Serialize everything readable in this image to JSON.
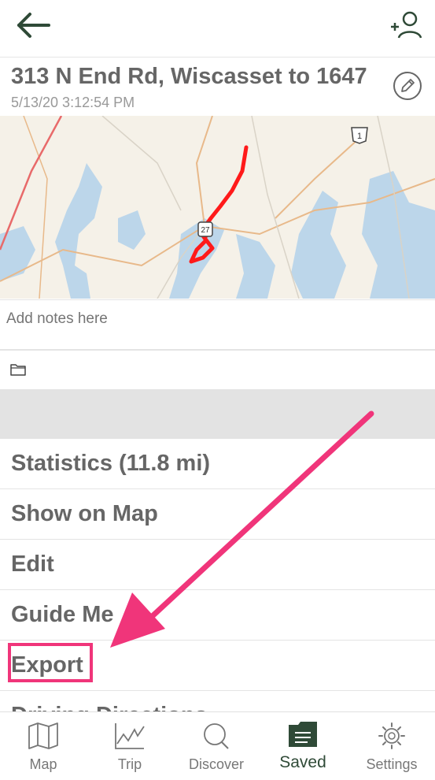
{
  "header": {
    "back_icon": "arrow-left-icon",
    "add_user_icon": "add-user-icon"
  },
  "route": {
    "title": "313 N End Rd, Wiscasset to 1647",
    "timestamp": "5/13/20 3:12:54 PM",
    "edit_icon": "pencil-icon"
  },
  "map": {
    "highway_shield_1": "1",
    "highway_shield_2": "27",
    "track_color": "#ff1a1a"
  },
  "notes": {
    "placeholder": "Add notes here"
  },
  "folder": {
    "icon": "folder-icon"
  },
  "menu": {
    "items": [
      {
        "label": "Statistics (11.8 mi)"
      },
      {
        "label": "Show on Map"
      },
      {
        "label": "Edit"
      },
      {
        "label": "Guide Me"
      },
      {
        "label": "Export"
      },
      {
        "label": "Driving Directions"
      }
    ]
  },
  "nav": {
    "items": [
      {
        "label": "Map",
        "icon": "map-icon"
      },
      {
        "label": "Trip",
        "icon": "chart-icon"
      },
      {
        "label": "Discover",
        "icon": "search-icon"
      },
      {
        "label": "Saved",
        "icon": "saved-folder-icon",
        "active": true
      },
      {
        "label": "Settings",
        "icon": "gear-icon"
      }
    ]
  },
  "colors": {
    "accent": "#2f4a37",
    "annotation": "#f0357a"
  }
}
